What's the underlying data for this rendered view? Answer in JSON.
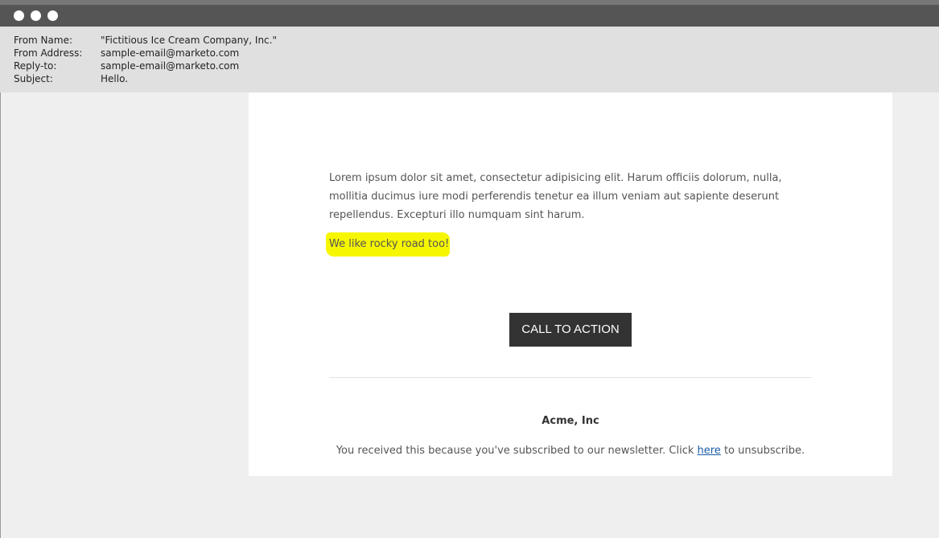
{
  "window": {
    "controls": [
      "window-dot",
      "window-dot",
      "window-dot"
    ]
  },
  "email_header": {
    "rows": [
      {
        "label": "From Name:",
        "value": "\"Fictitious Ice Cream Company, Inc.\""
      },
      {
        "label": "From Address:",
        "value": "sample-email@marketo.com"
      },
      {
        "label": "Reply-to:",
        "value": "sample-email@marketo.com"
      },
      {
        "label": "Subject:",
        "value": "Hello."
      }
    ]
  },
  "email_body": {
    "paragraph": "Lorem ipsum dolor sit amet, consectetur adipisicing elit. Harum officiis dolorum, nulla, mollitia ducimus iure modi perferendis tenetur ea illum veniam aut sapiente deserunt repellendus. Excepturi illo numquam sint harum.",
    "highlight_text": "We like rocky road too!",
    "highlight_color": "#f6f600",
    "cta_label": "CALL TO ACTION",
    "cta_color": "#333333"
  },
  "footer": {
    "company": "Acme, Inc",
    "text_before_link": "You received this because you've subscribed to our newsletter. Click ",
    "link_text": "here",
    "text_after_link": " to unsubscribe.",
    "link_color": "#1a5ba8"
  }
}
